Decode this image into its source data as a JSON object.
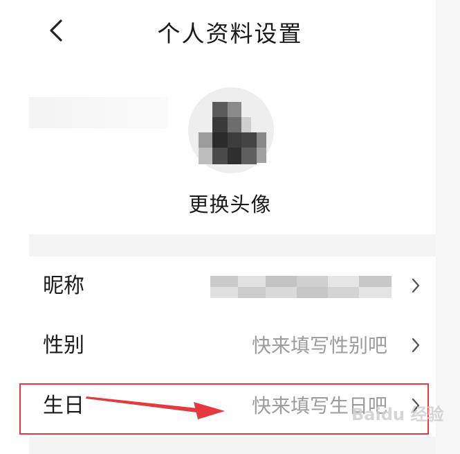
{
  "header": {
    "title": "个人资料设置",
    "back_icon": "chevron-left-icon"
  },
  "avatar": {
    "change_label": "更换头像"
  },
  "rows": [
    {
      "label": "昵称",
      "value": ""
    },
    {
      "label": "性别",
      "value": "快来填写性别吧"
    },
    {
      "label": "生日",
      "value": "快来填写生日吧"
    }
  ],
  "annotation": {
    "highlight_color": "#e33a40"
  },
  "watermark": {
    "text": "Baidu 经验"
  },
  "colors": {
    "text_primary": "#1a1a1a",
    "text_secondary": "#9c9c9c",
    "divider": "#f4f4f4"
  }
}
